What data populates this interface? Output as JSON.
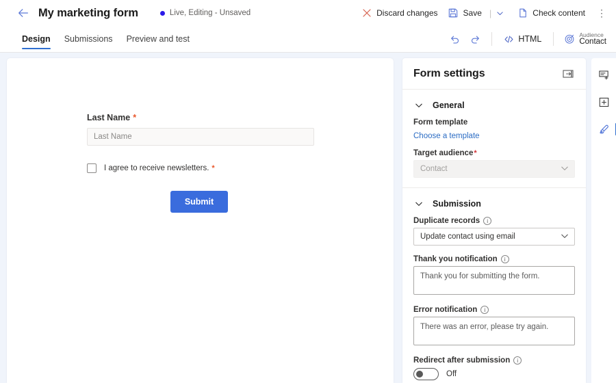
{
  "header": {
    "back_icon": "arrow-left-icon",
    "title": "My marketing form",
    "status_text": "Live, Editing - Unsaved",
    "status_dot_color": "#2b1ae8",
    "actions": [
      {
        "id": "discard-changes",
        "label": "Discard changes",
        "icon": "close-x-icon"
      },
      {
        "id": "save",
        "label": "Save",
        "icon": "save-disk-icon"
      },
      {
        "id": "check-content",
        "label": "Check content",
        "icon": "document-icon"
      }
    ],
    "overflow_label": "⋮"
  },
  "tabbar": {
    "tabs": [
      {
        "id": "design",
        "label": "Design",
        "active": true
      },
      {
        "id": "submissions",
        "label": "Submissions",
        "active": false
      },
      {
        "id": "preview-and-test",
        "label": "Preview and test",
        "active": false
      }
    ],
    "undo_icon": "undo-icon",
    "redo_icon": "redo-icon",
    "html_label": "HTML",
    "html_icon": "code-icon",
    "audience_icon": "target-icon",
    "audience_caption": "Audience",
    "audience_value": "Contact"
  },
  "canvas": {
    "field": {
      "label": "Last Name",
      "required_marker": "*",
      "placeholder": "Last Name"
    },
    "consent": {
      "label": "I agree to receive newsletters.",
      "required_marker": "*",
      "checked": false
    },
    "submit_label": "Submit",
    "submit_color": "#3a6cdd"
  },
  "settings": {
    "title": "Form settings",
    "collapse_icon": "panel-collapse-icon",
    "general": {
      "section_label": "General",
      "chevron_icon": "chevron-down-icon",
      "form_template_label": "Form template",
      "choose_template_link": "Choose a template",
      "target_audience_label": "Target audience",
      "target_audience_required": "*",
      "target_audience_value": "Contact",
      "target_audience_disabled": true
    },
    "submission": {
      "section_label": "Submission",
      "chevron_icon": "chevron-down-icon",
      "duplicate_records_label": "Duplicate records",
      "duplicate_records_value": "Update contact using email",
      "thank_you_label": "Thank you notification",
      "thank_you_value": "Thank you for submitting the form.",
      "error_label": "Error notification",
      "error_value": "There was an error, please try again.",
      "redirect_label": "Redirect after submission",
      "redirect_state": "Off"
    }
  },
  "rail": {
    "items": [
      {
        "id": "add-field",
        "icon": "add-field-icon",
        "selected": false
      },
      {
        "id": "add-section",
        "icon": "add-section-icon",
        "selected": false
      },
      {
        "id": "style",
        "icon": "brush-style-icon",
        "selected": true
      }
    ]
  }
}
